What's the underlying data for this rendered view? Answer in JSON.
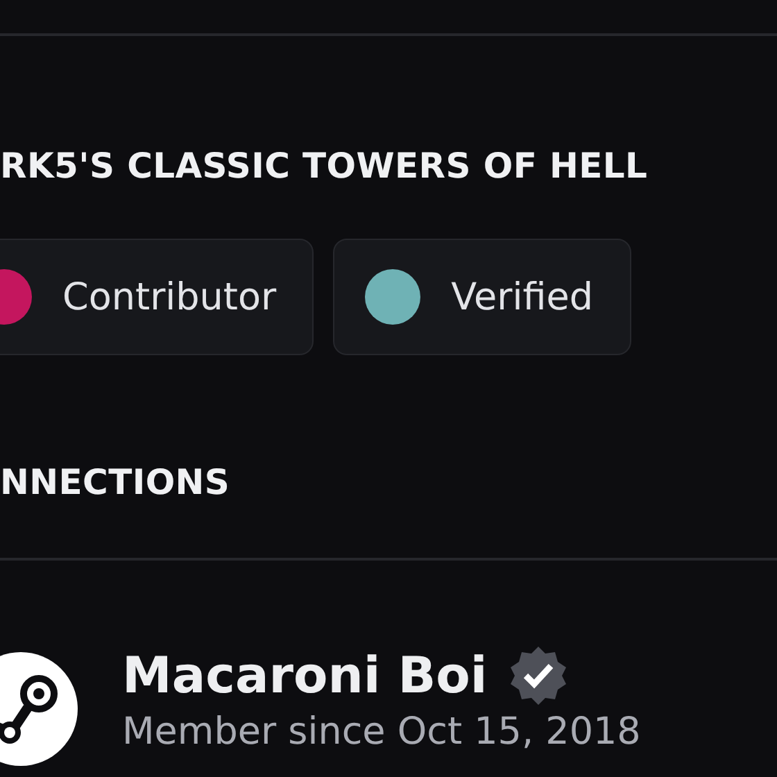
{
  "server_section": {
    "heading": "RK5'S CLASSIC TOWERS OF HELL",
    "roles": [
      {
        "name": "Contributor",
        "color": "#c4165e"
      },
      {
        "name": "Verified",
        "color": "#6fb2b5"
      }
    ]
  },
  "connections": {
    "heading": "NNECTIONS",
    "accounts": [
      {
        "kind": "steam",
        "name": "Macaroni Boi",
        "verified": true,
        "subtitle": "Member since Oct 15, 2018"
      }
    ]
  }
}
